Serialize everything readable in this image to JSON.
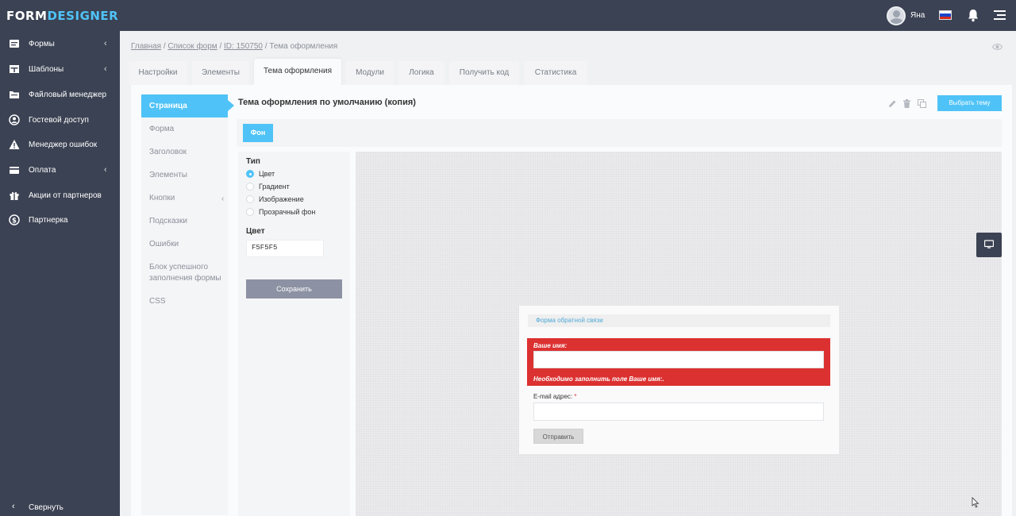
{
  "app": {
    "logo_part1": "FORM",
    "logo_part2": "DESIGNER",
    "user_name": "Яна"
  },
  "sidebar": {
    "items": [
      {
        "label": "Формы",
        "icon": "forms-icon",
        "has_chevron": true
      },
      {
        "label": "Шаблоны",
        "icon": "templates-icon",
        "has_chevron": true
      },
      {
        "label": "Файловый менеджер",
        "icon": "file-manager-icon",
        "has_chevron": false
      },
      {
        "label": "Гостевой доступ",
        "icon": "guest-access-icon",
        "has_chevron": false
      },
      {
        "label": "Менеджер ошибок",
        "icon": "warning-icon",
        "has_chevron": false
      },
      {
        "label": "Оплата",
        "icon": "payment-icon",
        "has_chevron": true
      },
      {
        "label": "Акции от партнеров",
        "icon": "gift-icon",
        "has_chevron": false
      },
      {
        "label": "Партнерка",
        "icon": "dollar-icon",
        "has_chevron": false
      }
    ],
    "collapse_label": "Свернуть"
  },
  "breadcrumb": {
    "home": "Главная",
    "sep1": " / ",
    "forms_list": "Список форм",
    "sep2": " / ",
    "form_id": "ID: 150750",
    "sep3": " / ",
    "current": "Тема оформления"
  },
  "tabs": [
    {
      "label": "Настройки"
    },
    {
      "label": "Элементы"
    },
    {
      "label": "Тема оформления",
      "active": true
    },
    {
      "label": "Модули"
    },
    {
      "label": "Логика"
    },
    {
      "label": "Получить код"
    },
    {
      "label": "Статистика"
    }
  ],
  "subnav": {
    "active": "Страница",
    "items": [
      "Форма",
      "Заголовок",
      "Элементы",
      "Кнопки",
      "Подсказки",
      "Ошибки",
      "Блок успешного заполнения формы",
      "CSS"
    ]
  },
  "theme": {
    "title": "Тема оформления по умолчанию (копия)",
    "choose_button": "Выбрать тему",
    "bg_tab": "Фон"
  },
  "background_settings": {
    "type_label": "Тип",
    "options": [
      "Цвет",
      "Градиент",
      "Изображение",
      "Прозрачный фон"
    ],
    "selected": "Цвет",
    "color_label": "Цвет",
    "color_value": "F5F5F5",
    "save_label": "Сохранить"
  },
  "preview_form": {
    "title": "Форма обратной связи",
    "name_label": "Ваше имя:",
    "name_error": "Необходимо заполнить поле Ваше имя:.",
    "email_label": "E-mail адрес: ",
    "required_mark": "*",
    "submit_label": "Отправить"
  },
  "colors": {
    "accent": "#4fc3f7",
    "sidebar_bg": "#3b4253",
    "error_bg": "#dc3131"
  }
}
